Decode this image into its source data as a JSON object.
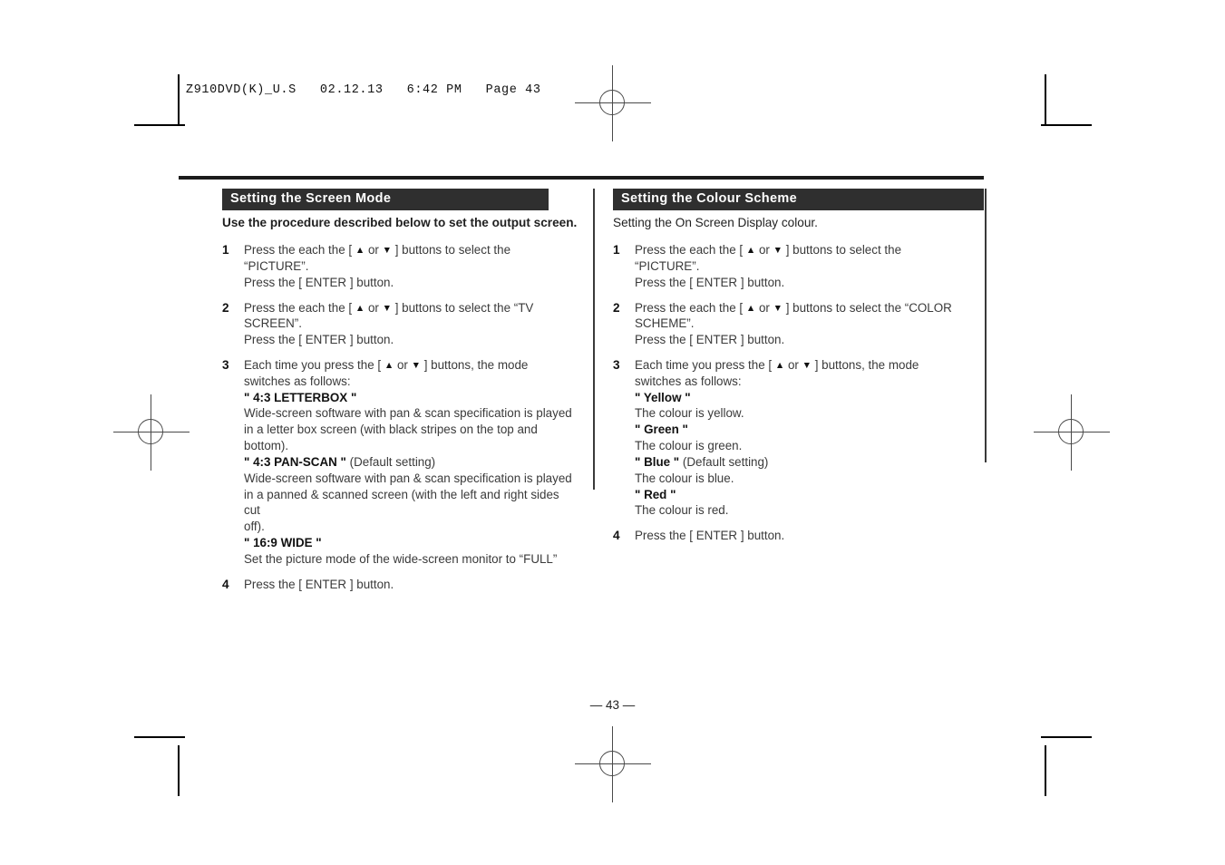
{
  "slug": "Z910DVD(K)_U.S   02.12.13   6:42 PM   Page 43",
  "folio": "— 43 —",
  "colors": {
    "section_bar_bg": "#2f2f2f",
    "section_bar_text": "#ffffff",
    "body_text": "#3a3a3a",
    "rule": "#1c1c1c"
  },
  "left_column": {
    "heading": "Setting the Screen Mode",
    "intro": "Use the procedure described below to set the output screen.",
    "steps": [
      {
        "number": "1",
        "lines": [
          {
            "type": "text",
            "pre": "Press the each the [ ",
            "tri1": "▲",
            "mid": " or ",
            "tri2": "▼",
            "post": " ] buttons to select the"
          },
          {
            "type": "plain",
            "text": "“PICTURE”."
          },
          {
            "type": "plain",
            "text": "Press the [ ENTER ] button."
          }
        ]
      },
      {
        "number": "2",
        "lines": [
          {
            "type": "text",
            "pre": "Press the each the [ ",
            "tri1": "▲",
            "mid": " or ",
            "tri2": "▼",
            "post": " ] buttons to select the “TV"
          },
          {
            "type": "plain",
            "text": "SCREEN”."
          },
          {
            "type": "plain",
            "text": "Press the [ ENTER ] button."
          }
        ]
      },
      {
        "number": "3",
        "lines": [
          {
            "type": "text",
            "pre": "Each time you press the [ ",
            "tri1": "▲",
            "mid": " or ",
            "tri2": "▼",
            "post": " ] buttons, the mode"
          },
          {
            "type": "plain",
            "text": "switches as follows:"
          },
          {
            "type": "mode",
            "label": "\" 4:3 LETTERBOX \"",
            "note": ""
          },
          {
            "type": "plain",
            "text": "Wide-screen software with pan & scan specification is played"
          },
          {
            "type": "plain",
            "text": "in a letter box screen (with black stripes on the top and"
          },
          {
            "type": "plain",
            "text": "bottom)."
          },
          {
            "type": "mode",
            "label": "\" 4:3 PAN-SCAN \"",
            "note": " (Default setting)"
          },
          {
            "type": "plain",
            "text": "Wide-screen software with pan & scan specification is played"
          },
          {
            "type": "plain",
            "text": "in a panned & scanned screen (with the left and right sides cut"
          },
          {
            "type": "plain",
            "text": "off)."
          },
          {
            "type": "mode",
            "label": "\" 16:9 WIDE \"",
            "note": ""
          },
          {
            "type": "plain",
            "text": "Set the picture mode of the wide-screen monitor to “FULL”"
          }
        ]
      },
      {
        "number": "4",
        "lines": [
          {
            "type": "plain",
            "text": "Press the [ ENTER ] button."
          }
        ]
      }
    ]
  },
  "right_column": {
    "heading": "Setting the Colour Scheme",
    "intro": "Setting the On Screen Display colour.",
    "steps": [
      {
        "number": "1",
        "lines": [
          {
            "type": "text",
            "pre": "Press the each the [ ",
            "tri1": "▲",
            "mid": " or ",
            "tri2": "▼",
            "post": " ] buttons to select the"
          },
          {
            "type": "plain",
            "text": "“PICTURE”."
          },
          {
            "type": "plain",
            "text": "Press the [ ENTER ] button."
          }
        ]
      },
      {
        "number": "2",
        "lines": [
          {
            "type": "text",
            "pre": "Press the each the [ ",
            "tri1": "▲",
            "mid": " or ",
            "tri2": "▼",
            "post": " ] buttons to select the “COLOR"
          },
          {
            "type": "plain",
            "text": "SCHEME”."
          },
          {
            "type": "plain",
            "text": "Press the [ ENTER ] button."
          }
        ]
      },
      {
        "number": "3",
        "lines": [
          {
            "type": "text",
            "pre": "Each time you press the [ ",
            "tri1": "▲",
            "mid": " or ",
            "tri2": "▼",
            "post": " ] buttons, the mode"
          },
          {
            "type": "plain",
            "text": "switches as follows:"
          },
          {
            "type": "mode",
            "label": "\" Yellow \"",
            "note": ""
          },
          {
            "type": "plain",
            "text": "The colour is yellow."
          },
          {
            "type": "mode",
            "label": "\" Green \"",
            "note": ""
          },
          {
            "type": "plain",
            "text": "The colour is green."
          },
          {
            "type": "mode",
            "label": "\" Blue \"",
            "note": " (Default setting)"
          },
          {
            "type": "plain",
            "text": "The colour is blue."
          },
          {
            "type": "mode",
            "label": "\" Red \"",
            "note": ""
          },
          {
            "type": "plain",
            "text": "The colour is red."
          }
        ]
      },
      {
        "number": "4",
        "lines": [
          {
            "type": "plain",
            "text": "Press the [ ENTER ] button."
          }
        ]
      }
    ]
  }
}
